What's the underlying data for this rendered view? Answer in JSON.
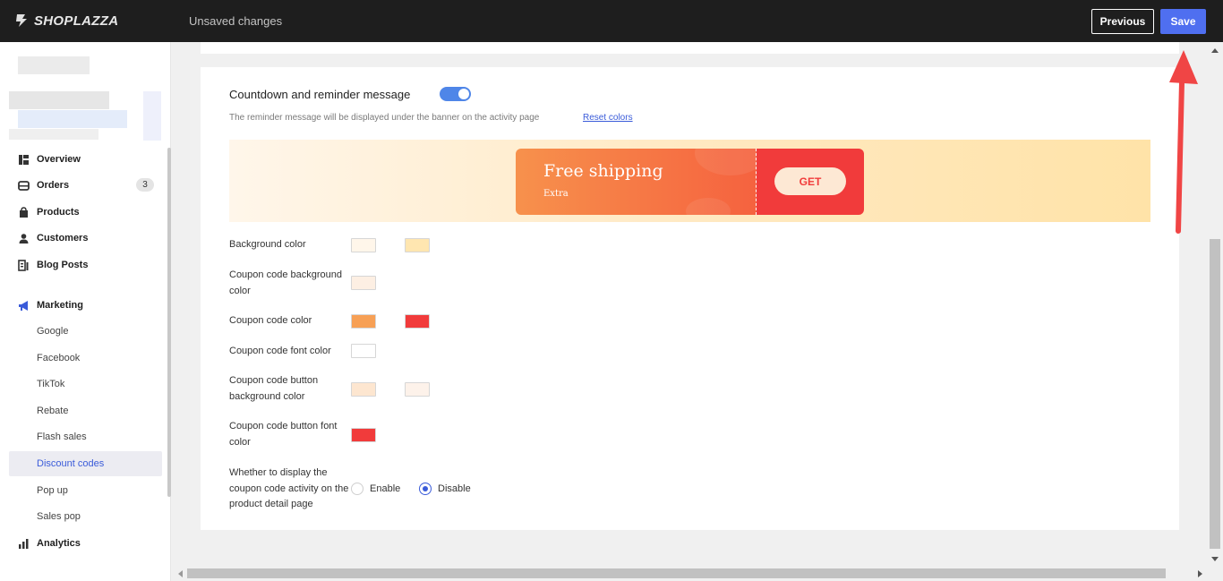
{
  "app": {
    "logo_text": "SHOPLAZZA",
    "status": "Unsaved changes",
    "previous_label": "Previous",
    "save_label": "Save"
  },
  "sidebar": {
    "items": [
      {
        "label": "Overview",
        "icon": "overview-icon"
      },
      {
        "label": "Orders",
        "icon": "orders-icon",
        "badge": "3"
      },
      {
        "label": "Products",
        "icon": "products-icon"
      },
      {
        "label": "Customers",
        "icon": "customers-icon"
      },
      {
        "label": "Blog Posts",
        "icon": "blog-icon"
      },
      {
        "label": "Marketing",
        "icon": "megaphone-icon"
      },
      {
        "label": "Analytics",
        "icon": "analytics-icon"
      }
    ],
    "marketing_sub": [
      "Google",
      "Facebook",
      "TikTok",
      "Rebate",
      "Flash sales",
      "Discount codes",
      "Pop up",
      "Sales pop"
    ],
    "active_sub": "Discount codes"
  },
  "settings": {
    "title": "Countdown and reminder message",
    "toggle_on": true,
    "help_text": "The reminder message will be displayed under the banner on the activity page",
    "reset_label": "Reset colors",
    "preview": {
      "title": "Free shipping",
      "subtitle": "Extra",
      "button": "GET"
    },
    "colors": {
      "background_color": {
        "label": "Background color",
        "values": [
          "#fff6ea",
          "#ffe6b0"
        ]
      },
      "coupon_bg": {
        "label": "Coupon code background color",
        "values": [
          "#fdefe3"
        ]
      },
      "coupon_color": {
        "label": "Coupon code color",
        "values": [
          "#f7a055",
          "#f13b3b"
        ]
      },
      "coupon_font": {
        "label": "Coupon code font color",
        "values": [
          "#ffffff"
        ]
      },
      "button_bg": {
        "label": "Coupon code button background color",
        "values": [
          "#fde6d0",
          "#fdf2ea"
        ]
      },
      "button_font": {
        "label": "Coupon code button font color",
        "values": [
          "#f13b3b"
        ]
      }
    },
    "display_option": {
      "label": "Whether to display the coupon code activity on the product detail page",
      "options": [
        "Enable",
        "Disable"
      ],
      "selected": "Disable"
    }
  },
  "accent_color": "#4f6ff0"
}
